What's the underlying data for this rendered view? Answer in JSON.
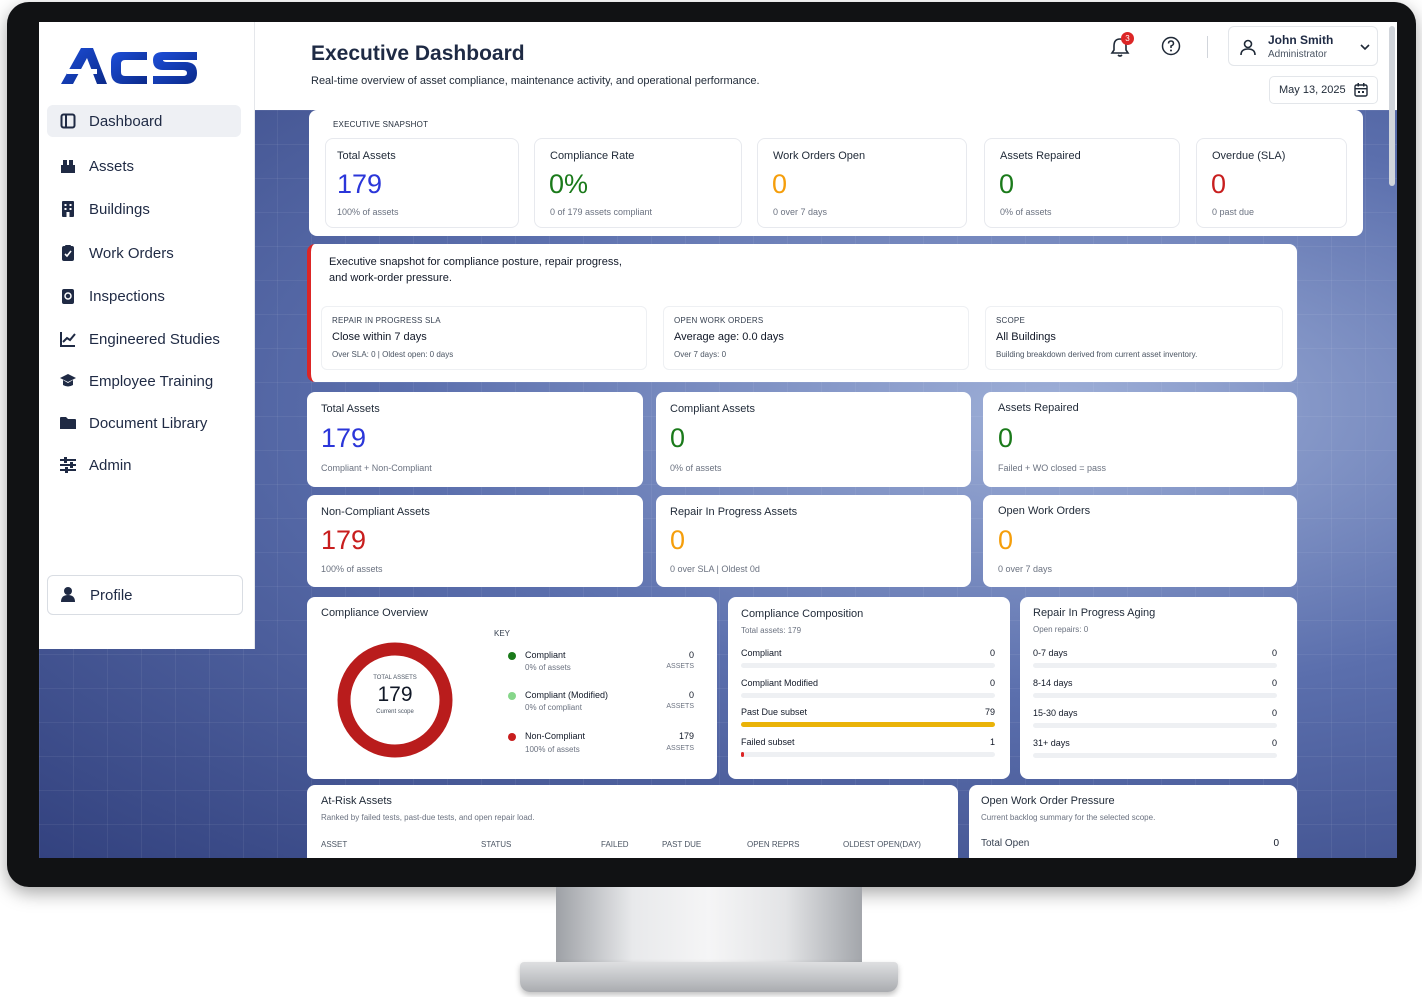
{
  "sidebar": {
    "logo_text": "ACS",
    "items": [
      {
        "label": "Dashboard",
        "icon": "dashboard-icon",
        "active": true
      },
      {
        "label": "Assets",
        "icon": "assets-icon"
      },
      {
        "label": "Buildings",
        "icon": "building-icon"
      },
      {
        "label": "Work Orders",
        "icon": "clipboard-icon"
      },
      {
        "label": "Inspections",
        "icon": "inspection-icon"
      },
      {
        "label": "Engineered Studies",
        "icon": "chart-line-icon"
      },
      {
        "label": "Employee Training",
        "icon": "graduation-cap-icon"
      },
      {
        "label": "Document Library",
        "icon": "folder-icon"
      },
      {
        "label": "Admin",
        "icon": "sliders-icon"
      }
    ],
    "profile_label": "Profile"
  },
  "header": {
    "title": "Executive Dashboard",
    "subtitle": "Real-time overview of asset compliance, maintenance activity, and operational performance.",
    "notification_count": "3",
    "user_name": "John Smith",
    "user_role": "Administrator",
    "date": "May 13, 2025"
  },
  "snapshot": {
    "title": "EXECUTIVE SNAPSHOT",
    "cards": [
      {
        "label": "Total Assets",
        "value": "179",
        "note": "100% of assets",
        "color": "#2b36d9"
      },
      {
        "label": "Compliance Rate",
        "value": "0%",
        "note": "0 of 179 assets compliant",
        "color": "#1a7a1a"
      },
      {
        "label": "Work Orders Open",
        "value": "0",
        "note": "0 over 7 days",
        "color": "#f59e0b"
      },
      {
        "label": "Assets Repaired",
        "value": "0",
        "note": "0% of assets",
        "color": "#1a7a1a"
      },
      {
        "label": "Overdue (SLA)",
        "value": "0",
        "note": "0 past due",
        "color": "#c81e1e"
      }
    ]
  },
  "info": {
    "heading": "Executive snapshot for compliance posture, repair progress, and work-order pressure.",
    "cards": [
      {
        "caption": "REPAIR IN PROGRESS SLA",
        "value": "Close within 7 days",
        "note": "Over SLA: 0 | Oldest open: 0 days"
      },
      {
        "caption": "OPEN WORK ORDERS",
        "value": "Average age: 0.0 days",
        "note": "Over 7 days: 0"
      },
      {
        "caption": "SCOPE",
        "value": "All Buildings",
        "note": "Building breakdown derived from current asset inventory."
      }
    ]
  },
  "kpis": [
    {
      "label": "Total Assets",
      "value": "179",
      "note": "Compliant + Non-Compliant",
      "color": "#2b36d9"
    },
    {
      "label": "Compliant Assets",
      "value": "0",
      "note": "0% of assets",
      "color": "#1a7a1a"
    },
    {
      "label": "Assets Repaired",
      "value": "0",
      "note": "Failed + WO closed = pass",
      "color": "#1a7a1a"
    },
    {
      "label": "Non-Compliant Assets",
      "value": "179",
      "note": "100% of assets",
      "color": "#c81e1e"
    },
    {
      "label": "Repair In Progress Assets",
      "value": "0",
      "note": "0 over SLA | Oldest 0d",
      "color": "#f59e0b"
    },
    {
      "label": "Open Work Orders",
      "value": "0",
      "note": "0 over 7 days",
      "color": "#f59e0b"
    }
  ],
  "compliance_overview": {
    "title": "Compliance Overview",
    "donut_caption": "TOTAL ASSETS",
    "donut_value": "179",
    "donut_note": "Current scope",
    "key_label": "KEY",
    "legend": [
      {
        "name": "Compliant",
        "sub": "0% of assets",
        "value": "0",
        "unit": "ASSETS",
        "color": "#1a7a1a"
      },
      {
        "name": "Compliant (Modified)",
        "sub": "0% of compliant",
        "value": "0",
        "unit": "ASSETS",
        "color": "#86d68a"
      },
      {
        "name": "Non-Compliant",
        "sub": "100% of assets",
        "value": "179",
        "unit": "ASSETS",
        "color": "#c81e1e"
      }
    ]
  },
  "composition": {
    "title": "Compliance Composition",
    "subtitle": "Total assets: 179",
    "rows": [
      {
        "label": "Compliant",
        "value": "0",
        "fraction": 0,
        "color": "#1a7a1a"
      },
      {
        "label": "Compliant Modified",
        "value": "0",
        "fraction": 0,
        "color": "#86d68a"
      },
      {
        "label": "Past Due subset",
        "value": "79",
        "fraction": 1,
        "color": "#eab308"
      },
      {
        "label": "Failed subset",
        "value": "1",
        "fraction": 0.01,
        "color": "#dc2626"
      }
    ]
  },
  "aging": {
    "title": "Repair In Progress Aging",
    "subtitle": "Open repairs: 0",
    "rows": [
      {
        "label": "0-7 days",
        "value": "0"
      },
      {
        "label": "8-14 days",
        "value": "0"
      },
      {
        "label": "15-30 days",
        "value": "0"
      },
      {
        "label": "31+ days",
        "value": "0"
      }
    ]
  },
  "at_risk": {
    "title": "At-Risk Assets",
    "subtitle": "Ranked by failed tests, past-due tests, and open repair load.",
    "columns": [
      "ASSET",
      "STATUS",
      "FAILED",
      "PAST DUE",
      "OPEN REPRS",
      "OLDEST OPEN(DAY)"
    ]
  },
  "pressure": {
    "title": "Open Work Order Pressure",
    "subtitle": "Current backlog summary for the selected scope.",
    "row_label": "Total Open",
    "row_value": "0"
  }
}
